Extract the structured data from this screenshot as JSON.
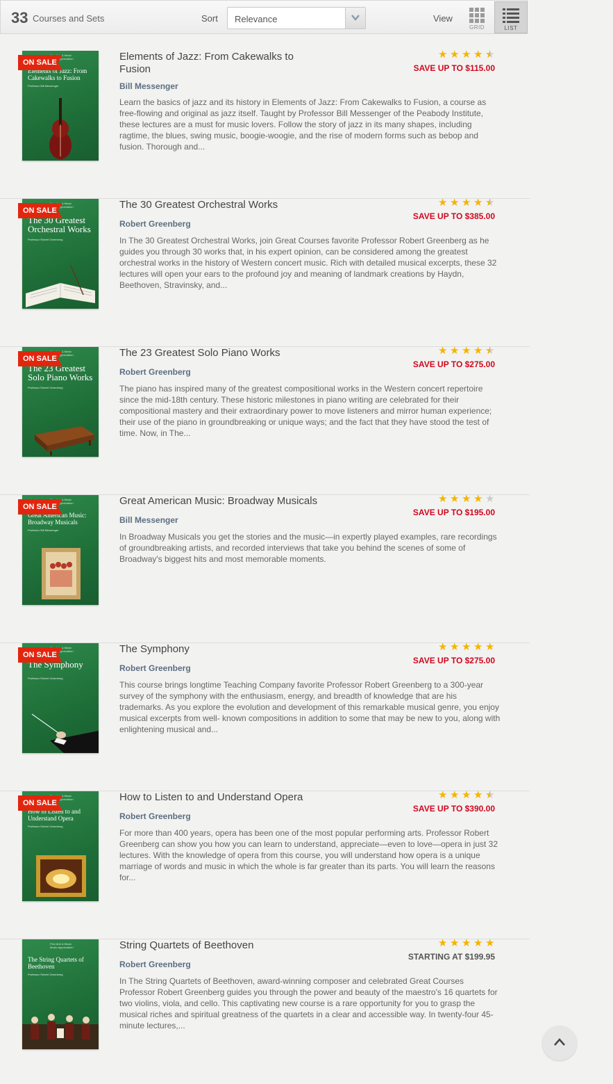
{
  "toolbar": {
    "count": "33",
    "count_label": "Courses and Sets",
    "sort_label": "Sort",
    "sort_value": "Relevance",
    "view_label": "View",
    "grid_label": "GRID",
    "list_label": "LIST",
    "active_view": "list"
  },
  "colors": {
    "sale_red": "#e2260e",
    "price_red": "#d0081e",
    "star_gold": "#f5b400",
    "cover_green": "#1e6e38",
    "author_blue": "#5c6e80"
  },
  "products": [
    {
      "title": "Elements of Jazz: From Cakewalks to Fusion",
      "author": "Bill Messenger",
      "description": "Learn the basics of jazz and its history in Elements of Jazz: From Cakewalks to Fusion, a course as free-flowing and original as jazz itself. Taught by Professor Bill Messenger of the Peabody Institute, these lectures are a must for music lovers. Follow the story of jazz in its many shapes, including ragtime, the blues, swing music, boogie-woogie, and the rise of modern forms such as bebop and fusion. Thorough and...",
      "rating": 4.5,
      "price": "SAVE UP TO $115.00",
      "badge": "ON SALE",
      "cover_title": "Elements of Jazz: From Cakewalks to Fusion",
      "cover_prof": "Professor Bill Messenger",
      "art": "double-bass"
    },
    {
      "title": "The 30 Greatest Orchestral Works",
      "author": "Robert Greenberg",
      "description": "In The 30 Greatest Orchestral Works, join Great Courses favorite Professor Robert Greenberg as he guides you through 30 works that, in his expert opinion, can be considered among the greatest orchestral works in the history of Western concert music. Rich with detailed musical excerpts, these 32 lectures will open your ears to the profound joy and meaning of landmark creations by Haydn, Beethoven, Stravinsky, and...",
      "rating": 4.5,
      "price": "SAVE UP TO $385.00",
      "badge": "ON SALE",
      "cover_title": "The 30 Greatest Orchestral Works",
      "cover_prof": "Professor Robert Greenberg",
      "art": "score-book"
    },
    {
      "title": "The 23 Greatest Solo Piano Works",
      "author": "Robert Greenberg",
      "description": "The piano has inspired many of the greatest compositional works in the Western concert repertoire since the mid-18th century. These historic milestones in piano writing are celebrated for their compositional mastery and their extraordinary power to move listeners and mirror human experience; their use of the piano in groundbreaking or unique ways; and the fact that they have stood the test of time. Now, in The...",
      "rating": 4.5,
      "price": "SAVE UP TO $275.00",
      "badge": "ON SALE",
      "cover_title": "The 23 Greatest Solo Piano Works",
      "cover_prof": "Professor Robert Greenberg",
      "art": "piano"
    },
    {
      "title": "Great American Music: Broadway Musicals",
      "author": "Bill Messenger",
      "description": "In Broadway Musicals you get the stories and the music—in expertly played examples, rare recordings of groundbreaking artists, and recorded interviews that take you behind the scenes of some of Broadway's biggest hits and most memorable moments.",
      "rating": 4,
      "price": "SAVE UP TO $195.00",
      "badge": "ON SALE",
      "cover_title": "Great American Music: Broadway Musicals",
      "cover_prof": "Professor Bill Messenger",
      "art": "poster"
    },
    {
      "title": "The Symphony",
      "author": "Robert Greenberg",
      "description": "This course brings longtime Teaching Company favorite Professor Robert Greenberg to a 300-year survey of the symphony with the enthusiasm, energy, and breadth of knowledge that are his trademarks. As you explore the evolution and development of this remarkable musical genre, you enjoy musical excerpts from well- known compositions in addition to some that may be new to you, along with enlightening musical and...",
      "rating": 5,
      "price": "SAVE UP TO $275.00",
      "badge": "ON SALE",
      "cover_title": "The Symphony",
      "cover_prof": "Professor Robert Greenberg",
      "art": "conductor"
    },
    {
      "title": "How to Listen to and Understand Opera",
      "author": "Robert Greenberg",
      "description": "For more than 400 years, opera has been one of the most popular performing arts. Professor Robert Greenberg can show you how you can learn to understand, appreciate—even to love—opera in just 32 lectures. With the knowledge of opera from this course, you will understand how opera is a unique marriage of words and music in which the whole is far greater than its parts. You will learn the reasons for...",
      "rating": 4.5,
      "price": "SAVE UP TO $390.00",
      "badge": "ON SALE",
      "cover_title": "How to Listen to and Understand Opera",
      "cover_prof": "Professor Robert Greenberg",
      "art": "opera-house"
    },
    {
      "title": "String Quartets of Beethoven",
      "author": "Robert Greenberg",
      "description": "In The String Quartets of Beethoven, award-winning composer and celebrated Great Courses Professor Robert Greenberg guides you through the power and beauty of the maestro's 16 quartets for two violins, viola, and cello. This captivating new course is a rare opportunity for you to grasp the musical riches and spiritual greatness of the quartets in a clear and accessible way. In twenty-four 45-minute lectures,...",
      "rating": 5,
      "price": "STARTING AT $199.95",
      "badge": "",
      "cover_title": "The String Quartets of Beethoven",
      "cover_prof": "Professor Robert Greenberg",
      "art": "quartet"
    }
  ]
}
